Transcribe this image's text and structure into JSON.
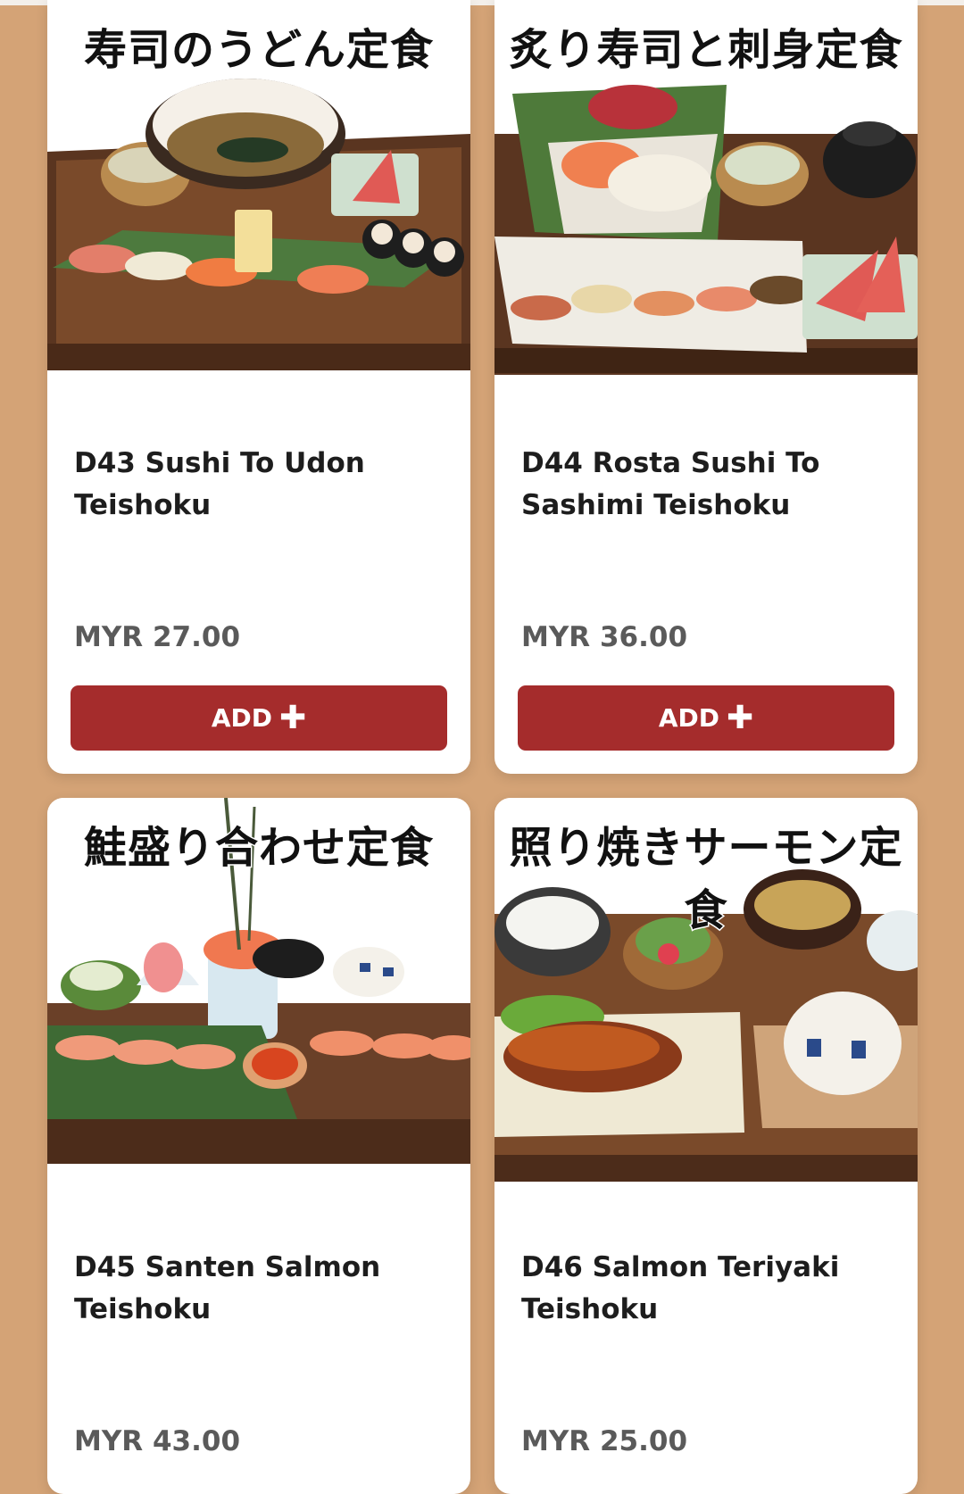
{
  "colors": {
    "background": "#d4a376",
    "accent": "#a52c2c",
    "card": "#ffffff"
  },
  "products": [
    {
      "jp_title": "寿司のうどん定食",
      "name": "D43 Sushi To Udon Teishoku",
      "price": "MYR 27.00",
      "add_label": "ADD",
      "add_icon": "plus-icon"
    },
    {
      "jp_title": "炙り寿司と刺身定食",
      "name": "D44 Rosta Sushi To Sashimi Teishoku",
      "price": "MYR 36.00",
      "add_label": "ADD",
      "add_icon": "plus-icon"
    },
    {
      "jp_title": "鮭盛り合わせ定食",
      "name": "D45 Santen Salmon Teishoku",
      "price": "MYR 43.00"
    },
    {
      "jp_title": "照り焼きサーモン定食",
      "name": "D46 Salmon Teriyaki Teishoku",
      "price": "MYR 25.00"
    }
  ]
}
